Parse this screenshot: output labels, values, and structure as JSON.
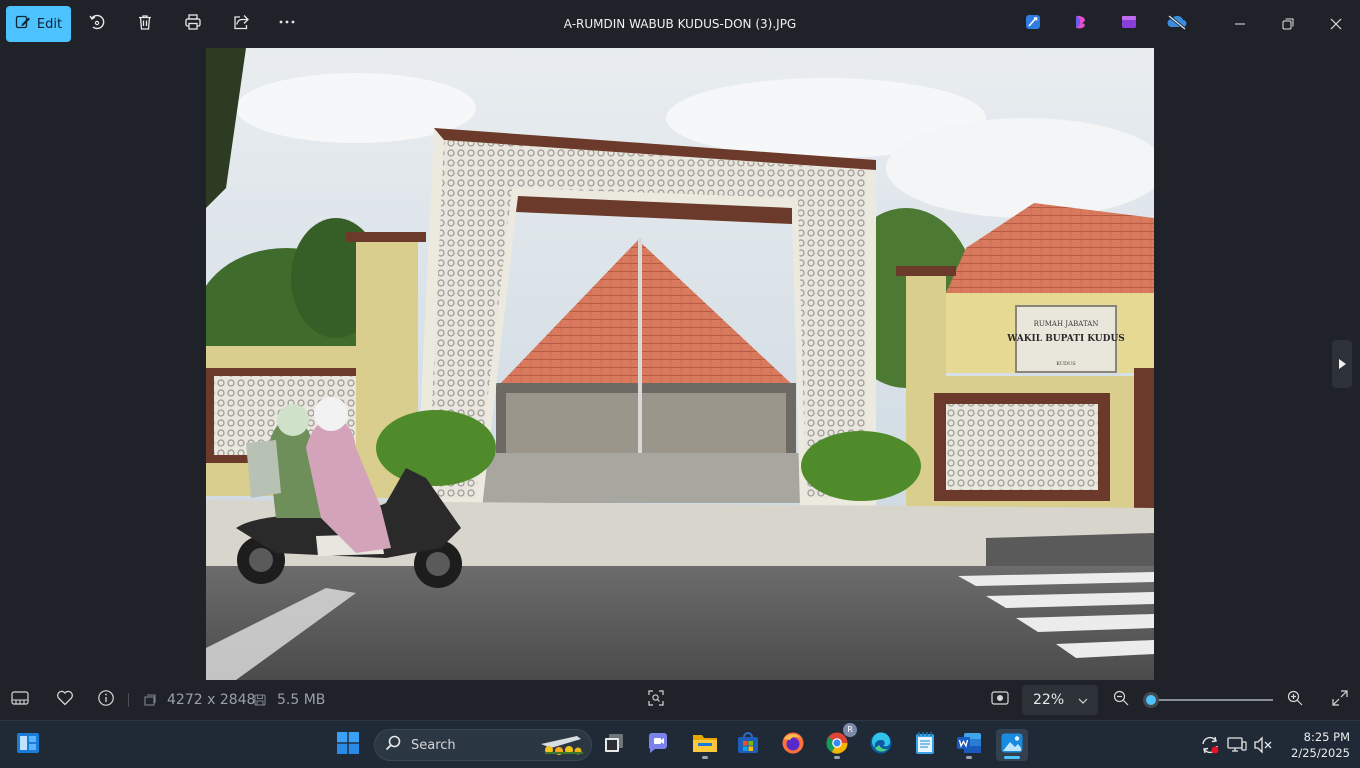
{
  "toolbar": {
    "edit_label": "Edit"
  },
  "window": {
    "title": "A-RUMDIN WABUB KUDUS-DON (3).JPG"
  },
  "photo": {
    "sign_line1": "RUMAH JABATAN",
    "sign_line2": "WAKIL BUPATI KUDUS",
    "sign_line3": "KUDUS"
  },
  "statusbar": {
    "dimensions": "4272 x 2848",
    "file_size": "5.5 MB",
    "zoom": "22%",
    "zoom_slider_fraction": 0.02
  },
  "taskbar": {
    "search_placeholder": "Search",
    "chrome_badge": "R",
    "time": "8:25 PM",
    "date": "2/25/2025"
  },
  "colors": {
    "accent": "#4cc2ff",
    "background": "#1f2329",
    "taskbar": "#202a36"
  }
}
